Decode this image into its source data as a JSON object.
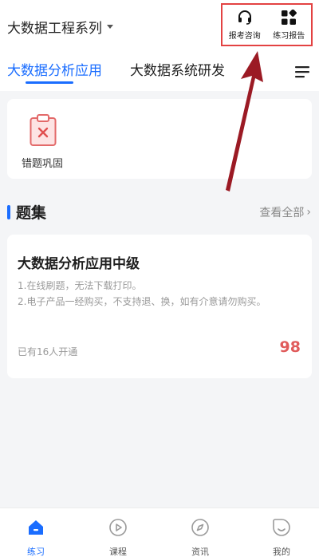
{
  "header": {
    "series_title": "大数据工程系列",
    "actions": [
      {
        "label": "报考咨询",
        "icon": "headset-icon"
      },
      {
        "label": "练习报告",
        "icon": "grid-apps-icon"
      }
    ],
    "highlight_color": "#e34242"
  },
  "tabs": [
    {
      "label": "大数据分析应用",
      "active": true
    },
    {
      "label": "大数据系统研发",
      "active": false
    }
  ],
  "quick_items": [
    {
      "label": "错题巩固",
      "icon": "clipboard-x-icon"
    }
  ],
  "question_sets": {
    "title": "题集",
    "view_all": "查看全部",
    "items": [
      {
        "title": "大数据分析应用中级",
        "desc_1": "1.在线刷题，无法下载打印。",
        "desc_2": "2.电子产品一经购买，不支持退、换，如有介意请勿购买。",
        "enrolled": "已有16人开通",
        "price": "98"
      }
    ]
  },
  "bottom_nav": [
    {
      "label": "练习",
      "icon": "home-icon",
      "active": true
    },
    {
      "label": "课程",
      "icon": "play-circle-icon",
      "active": false
    },
    {
      "label": "资讯",
      "icon": "compass-icon",
      "active": false
    },
    {
      "label": "我的",
      "icon": "smile-face-icon",
      "active": false
    }
  ],
  "colors": {
    "accent": "#1a6dff",
    "price": "#e05b5b",
    "arrow": "#9b1a24"
  }
}
